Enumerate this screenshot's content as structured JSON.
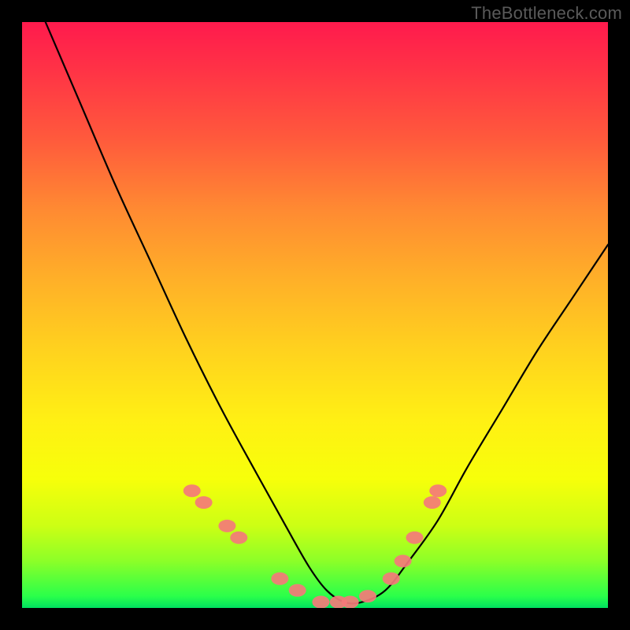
{
  "attribution": "TheBottleneck.com",
  "chart_data": {
    "type": "line",
    "title": "",
    "xlabel": "",
    "ylabel": "",
    "xlim": [
      0,
      100
    ],
    "ylim": [
      0,
      100
    ],
    "grid": false,
    "series": [
      {
        "name": "curve",
        "color": "#000000",
        "x": [
          4,
          10,
          16,
          22,
          28,
          34,
          40,
          45,
          49,
          52,
          55,
          58,
          62,
          66,
          71,
          76,
          82,
          88,
          94,
          100
        ],
        "y": [
          100,
          86,
          72,
          59,
          46,
          34,
          23,
          14,
          7,
          3,
          1,
          1,
          3,
          8,
          15,
          24,
          34,
          44,
          53,
          62
        ]
      },
      {
        "name": "markers",
        "color": "#f47a7a",
        "type": "scatter",
        "x": [
          29,
          31,
          35,
          37,
          44,
          47,
          51,
          54,
          56,
          59,
          63,
          65,
          67,
          70,
          71
        ],
        "y": [
          20,
          18,
          14,
          12,
          5,
          3,
          1,
          1,
          1,
          2,
          5,
          8,
          12,
          18,
          20
        ]
      }
    ],
    "background_gradient": {
      "direction": "vertical",
      "stops": [
        {
          "pos": 0.0,
          "color": "#ff1a4d"
        },
        {
          "pos": 0.5,
          "color": "#ffd21e"
        },
        {
          "pos": 0.8,
          "color": "#f7ff0a"
        },
        {
          "pos": 1.0,
          "color": "#00e060"
        }
      ]
    }
  }
}
